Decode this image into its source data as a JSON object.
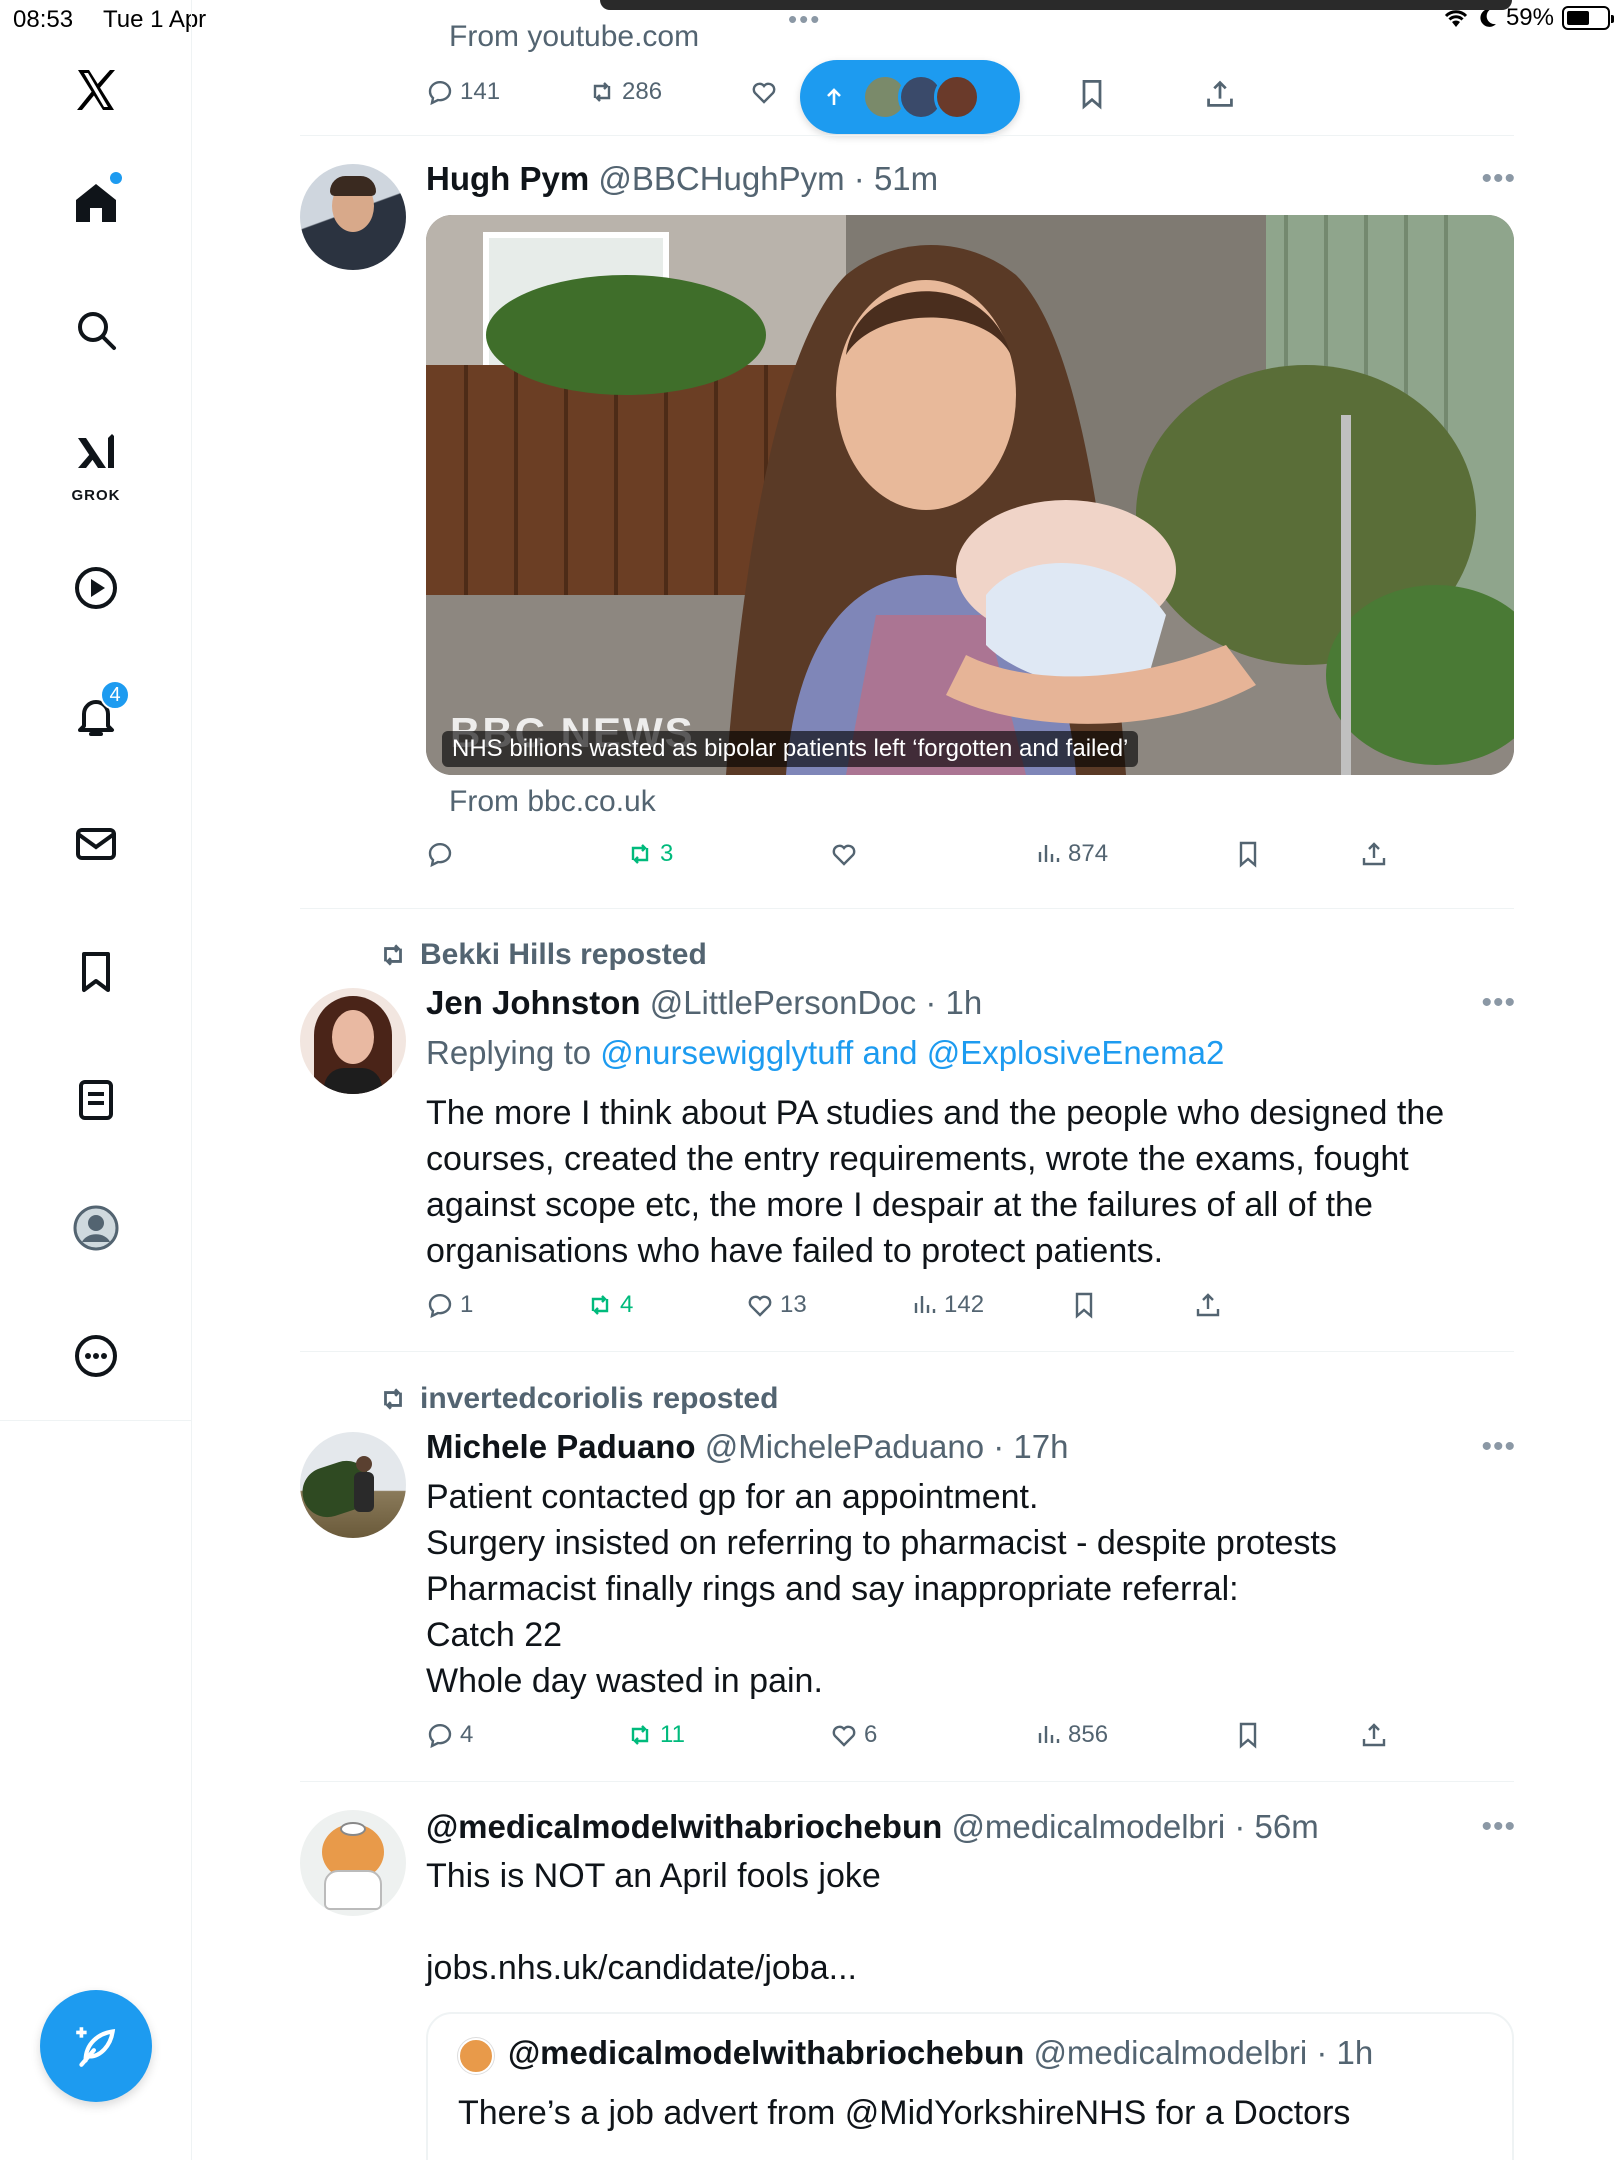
{
  "status": {
    "time": "08:53",
    "date": "Tue 1 Apr",
    "battery": "59%",
    "battery_level": 0.59
  },
  "sidebar": {
    "grok_label": "GROK",
    "notifications_count": "4",
    "items": [
      "x-logo",
      "home-icon",
      "search-icon",
      "grok-icon",
      "play-icon",
      "bell-icon",
      "mail-icon",
      "bookmark-icon",
      "lists-icon",
      "profile-icon",
      "more-icon"
    ]
  },
  "top_tweet": {
    "source": "From youtube.com",
    "replies": "141",
    "reposts": "286"
  },
  "tweets": [
    {
      "name": "Hugh Pym",
      "handle": "@BBCHughPym",
      "time": "51m",
      "media_caption": "NHS billions wasted as bipolar patients left ‘forgotten and failed’",
      "media_logo": "BBC NEWS",
      "source": "From bbc.co.uk",
      "replies": "",
      "reposts": "3",
      "likes": "",
      "views": "874"
    },
    {
      "repost_by": "Bekki Hills reposted",
      "name": "Jen Johnston",
      "handle": "@LittlePersonDoc",
      "time": "1h",
      "replying_prefix": "Replying to",
      "replying_to": "@nursewigglytuff and @ExplosiveEnema2",
      "text": "The more I think about PA studies and the people who designed the\ncourses, created the entry requirements, wrote the exams, fought\nagainst scope etc, the more I despair at the failures of all of the\norganisations who have failed to protect patients.",
      "replies": "1",
      "reposts": "4",
      "likes": "13",
      "views": "142"
    },
    {
      "repost_by": "invertedcoriolis reposted",
      "name": "Michele Paduano",
      "handle": "@MichelePaduano",
      "time": "17h",
      "text": "Patient contacted gp for an appointment.\nSurgery insisted on referring to pharmacist - despite protests\nPharmacist finally rings and say inappropriate referral:\nCatch 22\nWhole day wasted in pain.",
      "replies": "4",
      "reposts": "11",
      "likes": "6",
      "views": "856"
    },
    {
      "name": "@medicalmodelwithabriochebun",
      "handle": "@medicalmodelbri",
      "time": "56m",
      "text": "This is NOT an April fools joke",
      "link": "jobs.nhs.uk/candidate/joba...",
      "quote": {
        "name": "@medicalmodelwithabriochebun",
        "handle": "@medicalmodelbri",
        "time": "1h",
        "text": "There’s a job advert from @MidYorkshireNHS for a Doctors"
      }
    }
  ]
}
